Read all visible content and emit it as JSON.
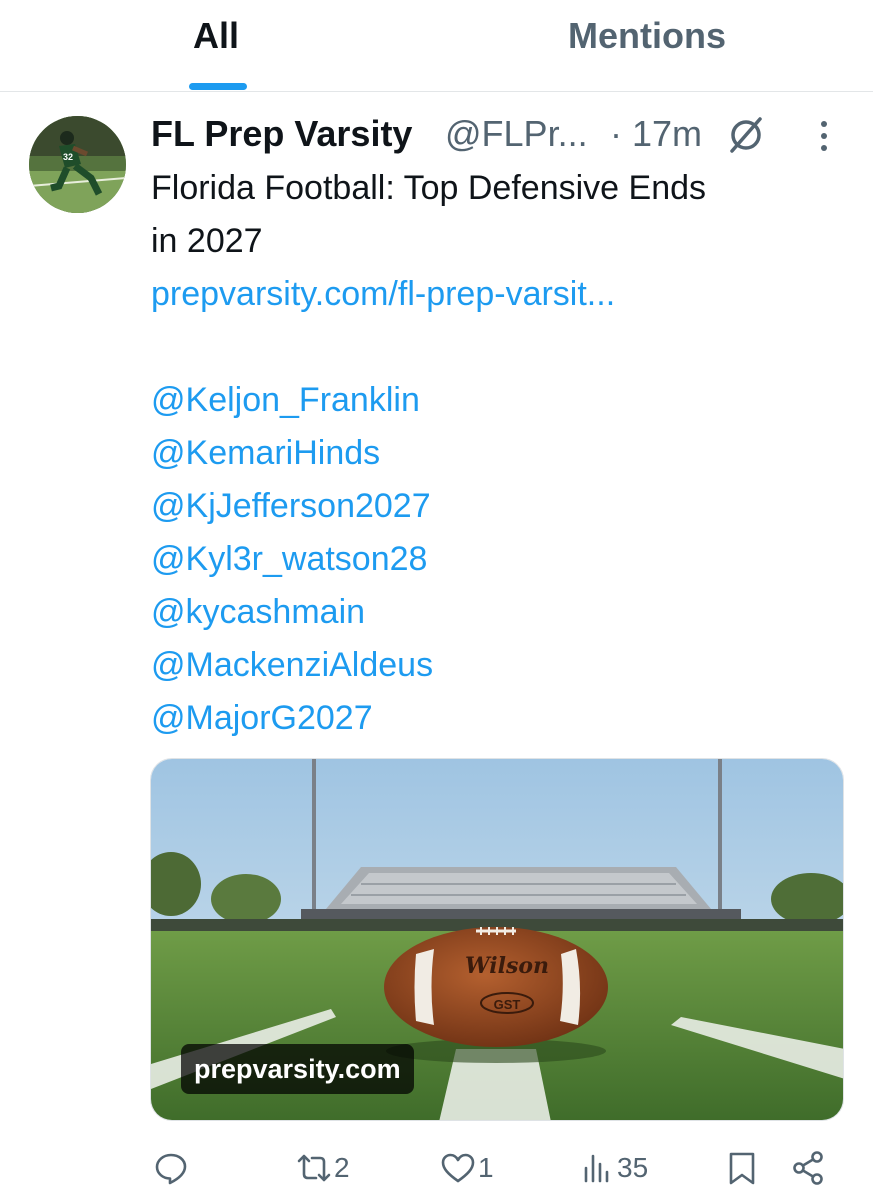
{
  "tabs": [
    {
      "label": "All",
      "selected": true
    },
    {
      "label": "Mentions",
      "selected": false
    }
  ],
  "colors": {
    "accent": "#1d9bf0",
    "text": "#0f1419",
    "secondary": "#536471",
    "divider": "#e3e6e8"
  },
  "post": {
    "author_name": "FL Prep Varsity",
    "author_handle": "@FLPr...",
    "time": "· 17m",
    "grok_icon": "grok-icon",
    "more_icon": "more-vertical-icon",
    "text_lines": [
      "Florida Football: Top Defensive Ends",
      "in 2027"
    ],
    "link": "prepvarsity.com/fl-prep-varsit...",
    "mentions": [
      "@Keljon_Franklin",
      "@KemariHinds",
      "@KjJefferson2027",
      "@Kyl3r_watson28",
      "@kycashmain",
      "@MackenziAldeus",
      "@MajorG2027"
    ],
    "media": {
      "domain": "prepvarsity.com",
      "ball_brand": "Wilson",
      "ball_mark": "GST"
    },
    "actions": {
      "reply": {
        "icon": "reply-icon",
        "count": ""
      },
      "repost": {
        "icon": "repost-icon",
        "count": "2"
      },
      "like": {
        "icon": "heart-icon",
        "count": "1"
      },
      "views": {
        "icon": "views-icon",
        "count": "35"
      },
      "bookmark": {
        "icon": "bookmark-icon"
      },
      "share": {
        "icon": "share-icon"
      }
    }
  }
}
